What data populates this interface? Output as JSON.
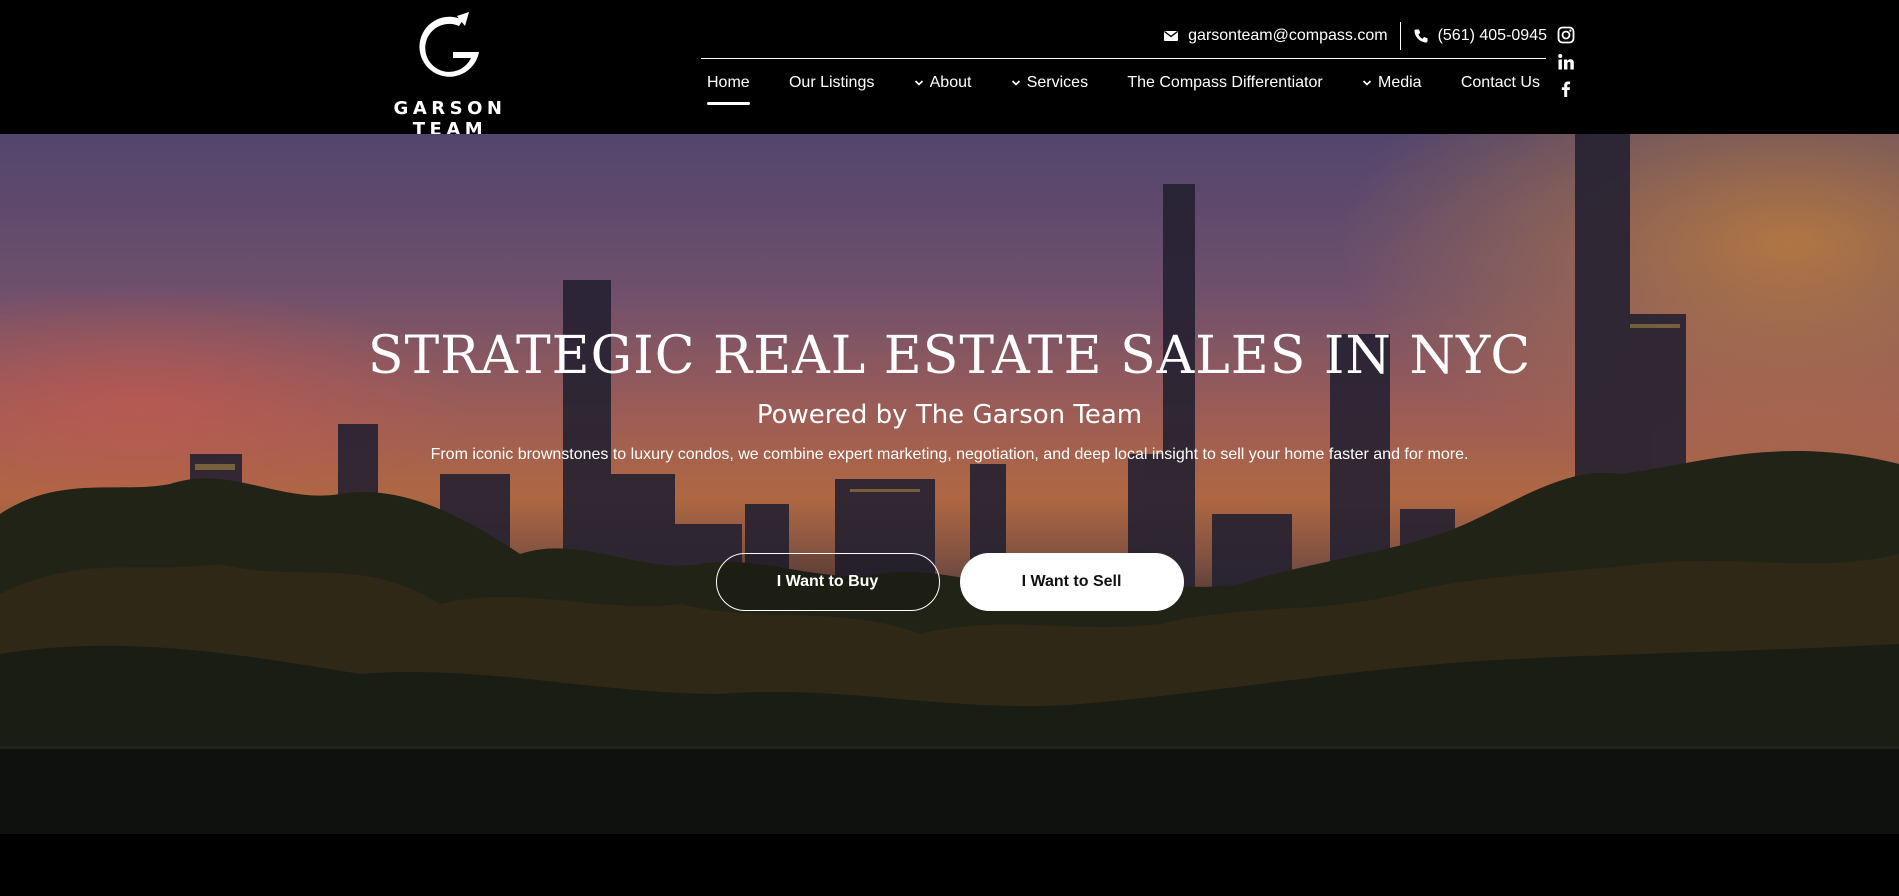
{
  "brand": {
    "logo_text": "GARSON TEAM"
  },
  "contact": {
    "email": "garsonteam@compass.com",
    "phone": "(561) 405-0945"
  },
  "nav": {
    "items": [
      {
        "label": "Home",
        "dropdown": false,
        "active": true
      },
      {
        "label": "Our Listings",
        "dropdown": false,
        "active": false
      },
      {
        "label": "About",
        "dropdown": true,
        "active": false
      },
      {
        "label": "Services",
        "dropdown": true,
        "active": false
      },
      {
        "label": "The Compass Differentiator",
        "dropdown": false,
        "active": false
      },
      {
        "label": "Media",
        "dropdown": true,
        "active": false
      },
      {
        "label": "Contact Us",
        "dropdown": false,
        "active": false
      }
    ]
  },
  "social": [
    "instagram-icon",
    "linkedin-icon",
    "facebook-icon"
  ],
  "hero": {
    "title": "STRATEGIC REAL ESTATE SALES IN NYC",
    "subtitle": "Powered by The Garson Team",
    "description": "From iconic brownstones to luxury condos, we combine expert marketing, negotiation, and deep local insight to sell your home faster and for more.",
    "buy_label": "I Want to Buy",
    "sell_label": "I Want to Sell"
  },
  "colors": {
    "header_bg": "#000000",
    "text": "#ffffff",
    "button_solid_bg": "#ffffff",
    "button_solid_text": "#111111"
  }
}
